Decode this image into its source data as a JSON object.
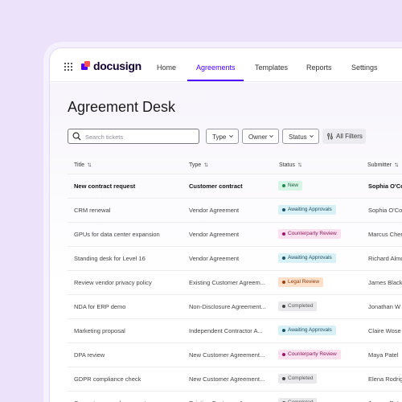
{
  "brand": {
    "name": "docusign",
    "mark_colors": [
      "#4c00ff",
      "#ff5252"
    ]
  },
  "nav": {
    "items": [
      {
        "label": "Home",
        "active": false
      },
      {
        "label": "Agreements",
        "active": true
      },
      {
        "label": "Templates",
        "active": false
      },
      {
        "label": "Reports",
        "active": false
      },
      {
        "label": "Settings",
        "active": false
      }
    ],
    "accent_color": "#4c00ff"
  },
  "page": {
    "title": "Agreement Desk"
  },
  "toolbar": {
    "search_placeholder": "Search tickets",
    "filters": [
      "Type",
      "Owner",
      "Status"
    ],
    "all_filters_label": "All Filters"
  },
  "table": {
    "columns": [
      "Title",
      "Type",
      "Status",
      "Submitter"
    ],
    "rows": [
      {
        "title": "New contract request",
        "type": "Customer contract",
        "status": "New",
        "status_kind": "new",
        "submitter": "Sophia O'Co"
      },
      {
        "title": "CRM renewal",
        "type": "Vendor Agreement",
        "status": "Awaiting Approvals",
        "status_kind": "awaiting",
        "submitter": "Sophia O'Co"
      },
      {
        "title": "GPUs for data center expansion",
        "type": "Vendor Agreement",
        "status": "Counterparty Review",
        "status_kind": "counterparty",
        "submitter": "Marcus Chen"
      },
      {
        "title": "Standing desk for Level 16",
        "type": "Vendor Agreement",
        "status": "Awaiting Approvals",
        "status_kind": "awaiting",
        "submitter": "Richard Almo"
      },
      {
        "title": "Review vendor privacy policy",
        "type": "Existing Customer Agreem...",
        "status": "Legal Review",
        "status_kind": "legal",
        "submitter": "James Black"
      },
      {
        "title": "NDA for ERP demo",
        "type": "Non-Disclosure Agreement...",
        "status": "Completed",
        "status_kind": "completed",
        "submitter": "Jonathan W"
      },
      {
        "title": "Marketing proposal",
        "type": "Independent Contractor A...",
        "status": "Awaiting Approvals",
        "status_kind": "awaiting",
        "submitter": "Claire Wose"
      },
      {
        "title": "DPA review",
        "type": "New Customer Agreement...",
        "status": "Counterparty Review",
        "status_kind": "counterparty",
        "submitter": "Maya Patel"
      },
      {
        "title": "GDPR compliance check",
        "type": "New Customer Agreement...",
        "status": "Completed",
        "status_kind": "completed",
        "submitter": "Elena Rodrig"
      },
      {
        "title": "Computer upgrade request",
        "type": "Existing Customer Agreem...",
        "status": "Completed",
        "status_kind": "completed",
        "submitter": "Jeremy Potr"
      }
    ]
  },
  "status_colors": {
    "new": {
      "bg": "#d6f5e6",
      "fg": "#1c5c3d",
      "dot": "#1f8a55"
    },
    "awaiting": {
      "bg": "#d8f1f7",
      "fg": "#1d4d5c",
      "dot": "#1a5266"
    },
    "counterparty": {
      "bg": "#fbe0f0",
      "fg": "#8a1a5a",
      "dot": "#a3126a"
    },
    "legal": {
      "bg": "#fde0c9",
      "fg": "#8a3b10",
      "dot": "#9a4210"
    },
    "completed": {
      "bg": "#e9e9ec",
      "fg": "#555",
      "dot": "#444"
    }
  }
}
